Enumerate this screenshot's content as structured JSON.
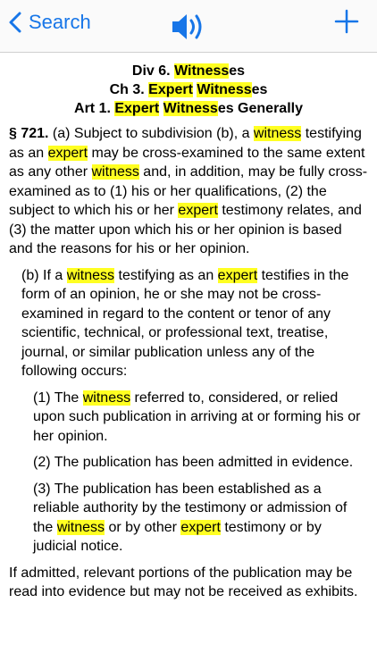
{
  "nav": {
    "back_label": "Search",
    "icons": {
      "back": "chevron-left-icon",
      "speaker": "speaker-icon",
      "add": "plus-icon"
    },
    "accent_color": "#1776e8"
  },
  "highlight_color": "#ffff22",
  "heading": {
    "div": {
      "prefix": "Div 6. ",
      "hl": "Witness",
      "suffix": "es"
    },
    "ch": {
      "prefix": "Ch 3. ",
      "hl1": "Expert",
      "mid": " ",
      "hl2": "Witness",
      "suffix": "es"
    },
    "art": {
      "prefix": "Art 1. ",
      "hl1": "Expert",
      "mid": " ",
      "hl2": "Witness",
      "suffix": "es Generally"
    }
  },
  "section": {
    "number": "§ 721.",
    "a": [
      " (a) Subject to subdivision (b), a ",
      "witness",
      " testifying as an ",
      "expert",
      " may be cross-examined to the same extent as any other ",
      "witness",
      " and, in addition, may be fully cross-examined as to (1) his or her qualifications, (2) the subject to which his or her ",
      "expert",
      " testimony relates, and (3) the matter upon which his or her opinion is based and the reasons for his or her opinion."
    ],
    "b": [
      "(b) If a ",
      "witness",
      " testifying as an ",
      "expert",
      " testifies in the form of an opinion, he or she may not be cross-examined in regard to the content or tenor of any scientific, technical, or professional text, treatise, journal, or similar publication unless any of the following occurs:"
    ],
    "b1": [
      "(1) The ",
      "witness",
      " referred to, considered, or relied upon such publication in arriving at or forming his or her opinion."
    ],
    "b2": "(2) The publication has been admitted in evidence.",
    "b3": [
      "(3) The publication has been established as a reliable authority by the testimony or admission of the ",
      "witness",
      " or by other ",
      "expert",
      " testimony or by judicial notice."
    ],
    "closing": "If admitted, relevant portions of the publication may be read into evidence but may not be received as exhibits."
  }
}
